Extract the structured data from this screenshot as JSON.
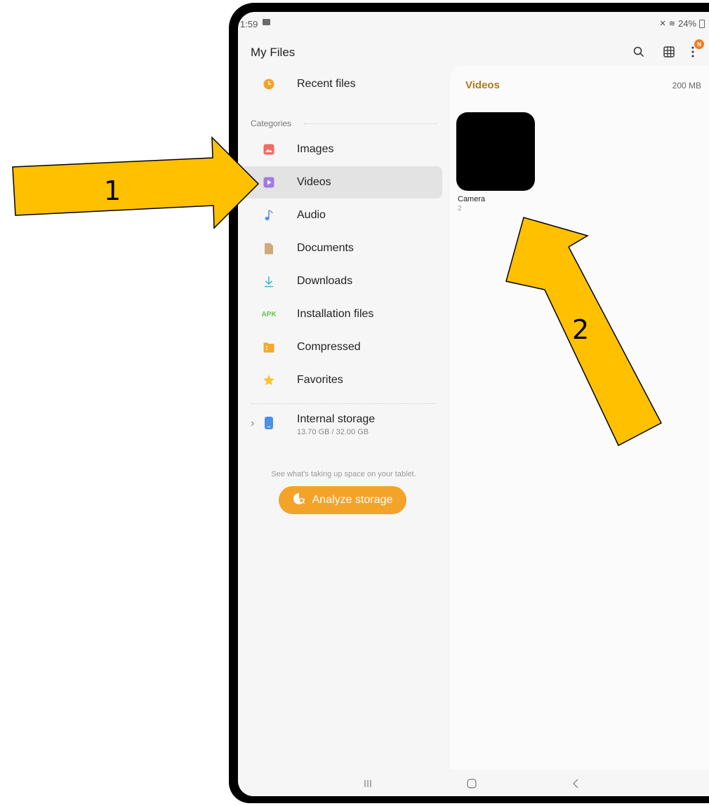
{
  "status_bar": {
    "time": "1:59",
    "battery": "24%"
  },
  "header": {
    "title": "My Files"
  },
  "sidebar": {
    "recent_label": "Recent files",
    "categories_label": "Categories",
    "items": [
      {
        "label": "Images",
        "icon": "image-icon",
        "color": "#ef6b63"
      },
      {
        "label": "Videos",
        "icon": "video-icon",
        "color": "#a27ae2",
        "selected": true
      },
      {
        "label": "Audio",
        "icon": "music-note-icon",
        "color": "#5a8ef0"
      },
      {
        "label": "Documents",
        "icon": "document-icon",
        "color": "#cfab7b"
      },
      {
        "label": "Downloads",
        "icon": "download-icon",
        "color": "#3fb0d9"
      },
      {
        "label": "Installation files",
        "icon": "apk-icon",
        "icon_text": "APK",
        "color": "#6cc24a"
      },
      {
        "label": "Compressed",
        "icon": "compressed-folder-icon",
        "color": "#f3a92a"
      },
      {
        "label": "Favorites",
        "icon": "star-icon",
        "color": "#f7c531"
      }
    ],
    "storage": {
      "name": "Internal storage",
      "usage": "13.70 GB / 32.00 GB"
    },
    "tip": "See what's taking up space on your tablet.",
    "analyze_label": "Analyze storage"
  },
  "panel": {
    "title": "Videos",
    "size": "200 MB",
    "folders": [
      {
        "name": "Camera",
        "count": "2"
      }
    ]
  },
  "annotations": {
    "arrow1_label": "1",
    "arrow2_label": "2",
    "arrow_color": "#ffc000"
  }
}
